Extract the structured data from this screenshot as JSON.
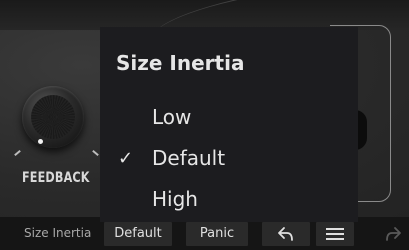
{
  "background": {
    "knob_label": "FEEDBACK"
  },
  "menu": {
    "title": "Size Inertia",
    "items": [
      {
        "label": "Low",
        "checked": false
      },
      {
        "label": "Default",
        "checked": true
      },
      {
        "label": "High",
        "checked": false
      }
    ],
    "check_mark": "✓"
  },
  "bottom_bar": {
    "param_name": "Size Inertia",
    "value_button": "Default",
    "panic_button": "Panic",
    "icons": [
      "undo-icon",
      "menu-icon",
      "redo-icon"
    ]
  },
  "colors": {
    "menu_bg": "#1c1c1f",
    "menu_text": "#e6e6e6",
    "bar_bg": "#151515"
  }
}
